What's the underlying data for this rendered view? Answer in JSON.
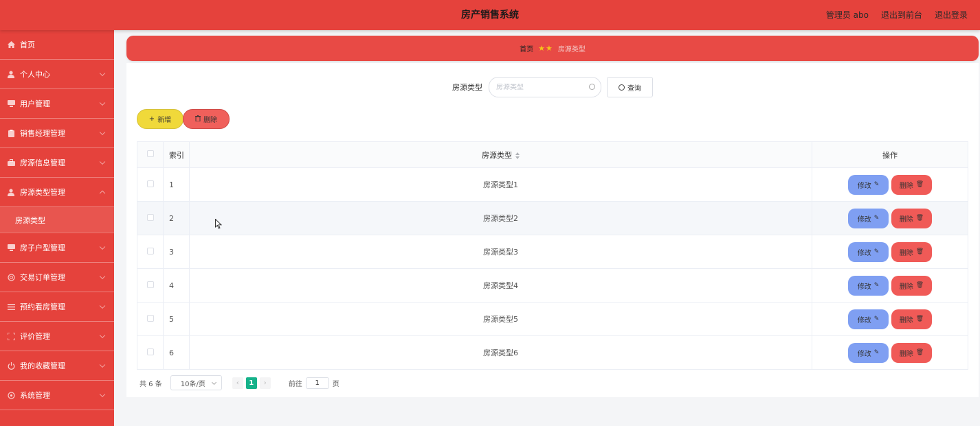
{
  "header": {
    "title": "房产销售系统",
    "admin": "管理员 abo",
    "to_front": "退出到前台",
    "logout": "退出登录"
  },
  "sidebar": {
    "items": [
      {
        "label": "首页",
        "icon": "home-icon"
      },
      {
        "label": "个人中心",
        "icon": "user-icon"
      },
      {
        "label": "用户管理",
        "icon": "monitor-icon"
      },
      {
        "label": "销售经理管理",
        "icon": "clipboard-icon"
      },
      {
        "label": "房源信息管理",
        "icon": "briefcase-icon"
      },
      {
        "label": "房源类型管理",
        "icon": "user-icon",
        "expanded": true
      },
      {
        "label": "房子户型管理",
        "icon": "monitor-icon"
      },
      {
        "label": "交易订单管理",
        "icon": "globe-icon"
      },
      {
        "label": "预约看房管理",
        "icon": "list-icon"
      },
      {
        "label": "评价管理",
        "icon": "frame-icon"
      },
      {
        "label": "我的收藏管理",
        "icon": "power-icon"
      },
      {
        "label": "系统管理",
        "icon": "settings-icon"
      }
    ],
    "subitem": "房源类型"
  },
  "breadcrumb": {
    "home": "首页",
    "current": "房源类型"
  },
  "search": {
    "label": "房源类型",
    "placeholder": "房源类型",
    "button": "查询"
  },
  "actions": {
    "add": "新增",
    "delete": "删除"
  },
  "table": {
    "headers": {
      "index": "索引",
      "type": "房源类型",
      "ops": "操作"
    },
    "rows": [
      {
        "index": "1",
        "type": "房源类型1"
      },
      {
        "index": "2",
        "type": "房源类型2"
      },
      {
        "index": "3",
        "type": "房源类型3"
      },
      {
        "index": "4",
        "type": "房源类型4"
      },
      {
        "index": "5",
        "type": "房源类型5"
      },
      {
        "index": "6",
        "type": "房源类型6"
      }
    ],
    "edit_label": "修改",
    "delete_label": "删除"
  },
  "pager": {
    "total": "共 6 条",
    "page_size": "10条/页",
    "current_page": "1",
    "goto_prefix": "前往",
    "goto_value": "1",
    "goto_suffix": "页"
  },
  "colors": {
    "brand_red": "#e5423c",
    "add_yellow": "#f0d93a",
    "edit_blue": "#7f9ff2",
    "delete_red": "#f05a57",
    "page_green": "#16b28a"
  }
}
